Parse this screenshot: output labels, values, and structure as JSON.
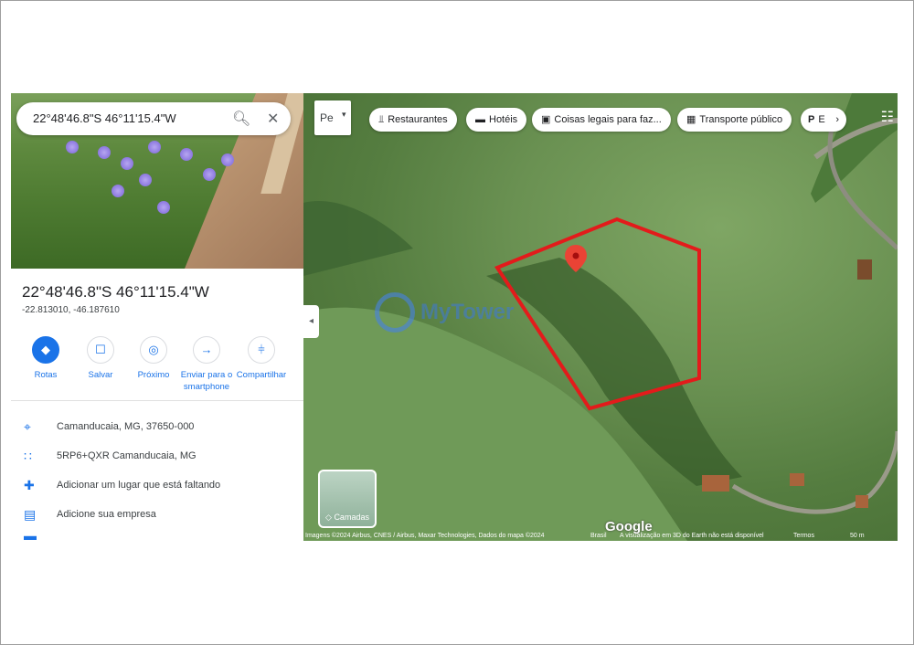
{
  "search": {
    "query": "22°48'46.8\"S 46°11'15.4\"W"
  },
  "place": {
    "title": "22°48'46.8\"S 46°11'15.4\"W",
    "decimal": "-22.813010, -46.187610"
  },
  "actions": [
    {
      "label": "Rotas",
      "icon": "directions-icon"
    },
    {
      "label": "Salvar",
      "icon": "bookmark-icon"
    },
    {
      "label": "Próximo",
      "icon": "nearby-icon"
    },
    {
      "label": "Enviar para o smartphone",
      "icon": "send-to-phone-icon"
    },
    {
      "label": "Compartilhar",
      "icon": "share-icon"
    }
  ],
  "info": [
    {
      "text": "Camanducaia, MG, 37650-000",
      "icon": "location-pin-icon"
    },
    {
      "text": "5RP6+QXR Camanducaia, MG",
      "icon": "plus-code-icon"
    },
    {
      "text": "Adicionar um lugar que está faltando",
      "icon": "add-place-icon"
    },
    {
      "text": "Adicione sua empresa",
      "icon": "add-business-icon"
    }
  ],
  "map": {
    "layer_selector": "Pe",
    "chips": [
      {
        "label": "Restaurantes",
        "icon": "restaurant-icon"
      },
      {
        "label": "Hotéis",
        "icon": "hotel-icon"
      },
      {
        "label": "Coisas legais para faz...",
        "icon": "camera-icon"
      },
      {
        "label": "Transporte público",
        "icon": "transit-icon"
      },
      {
        "label": "E",
        "icon": "parking-icon"
      }
    ],
    "layers_label": "Camadas",
    "brand": "Google",
    "attribution": "Imagens ©2024 Airbus, CNES / Airbus, Maxar Technologies, Dados do mapa ©2024",
    "country": "Brasil",
    "notice": "A visualização em 3D do Earth não está disponível",
    "terms": "Termos",
    "scale": "50 m",
    "watermark": "MyTower",
    "boundary_color": "#e31b1b",
    "pin_color": "#ea4335"
  }
}
